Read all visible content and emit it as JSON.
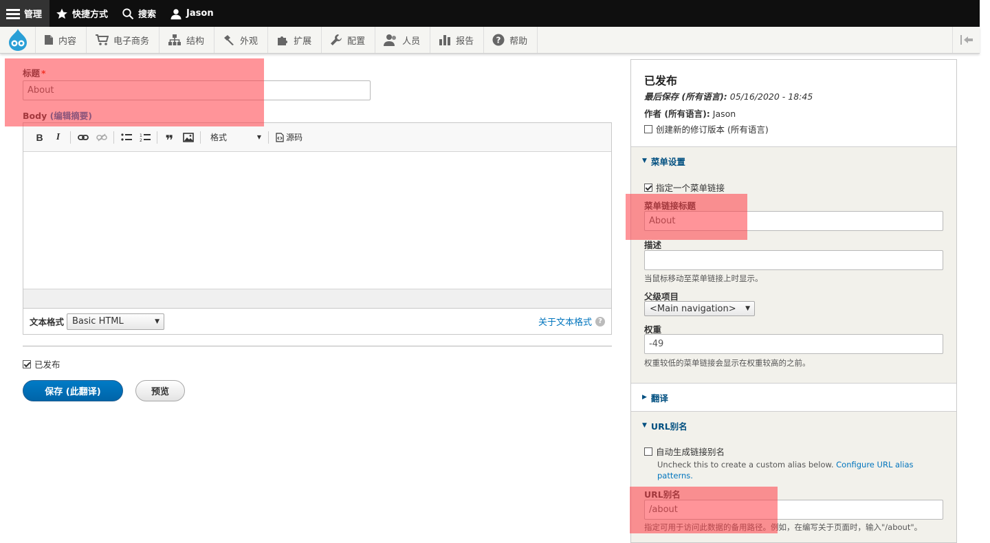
{
  "topbar": {
    "manage": "管理",
    "shortcuts": "快捷方式",
    "search": "搜索",
    "user": "Jason"
  },
  "tray": {
    "items": [
      "内容",
      "电子商务",
      "结构",
      "外观",
      "扩展",
      "配置",
      "人员",
      "报告",
      "帮助"
    ]
  },
  "form": {
    "title_label": "标题",
    "required_mark": "*",
    "title_value": "About",
    "body_label": "Body",
    "body_summary_link": "(编辑摘要)",
    "editor": {
      "format_label": "格式",
      "source_label": "源码"
    },
    "text_format_label": "文本格式",
    "text_format_value": "Basic HTML",
    "about_formats_link": "关于文本格式",
    "published_label": "已发布",
    "save_button": "保存 (此翻译)",
    "preview_button": "预览"
  },
  "sidebar": {
    "status_title": "已发布",
    "last_saved_label": "最后保存 (所有语言):",
    "last_saved_value": "05/16/2020 - 18:45",
    "author_label": "作者 (所有语言):",
    "author_value": "Jason",
    "new_revision_label": "创建新的修订版本 (所有语言)",
    "menu": {
      "title": "菜单设置",
      "provide_link_label": "指定一个菜单链接",
      "link_title_label": "菜单链接标题",
      "link_title_value": "About",
      "description_label": "描述",
      "description_value": "",
      "description_help": "当鼠标移动至菜单链接上时显示。",
      "parent_label": "父级项目",
      "parent_value": "<Main navigation>",
      "weight_label": "权重",
      "weight_value": "-49",
      "weight_help": "权重较低的菜单链接会显示在权重较高的之前。"
    },
    "translation": {
      "title": "翻译"
    },
    "url_alias": {
      "title": "URL别名",
      "auto_alias_label": "自动生成链接别名",
      "auto_alias_help": "Uncheck this to create a custom alias below.",
      "configure_link_a": "Configure URL alias",
      "configure_link_b": "patterns.",
      "alias_label": "URL别名",
      "alias_value": "/about",
      "alias_help": "指定可用于访问此数据的备用路径。例如，在编写关于页面时，输入\"/about\"。"
    }
  },
  "colors": {
    "primary_button": "#0074bd",
    "link": "#0074bd",
    "highlight": "#ff3c46"
  }
}
